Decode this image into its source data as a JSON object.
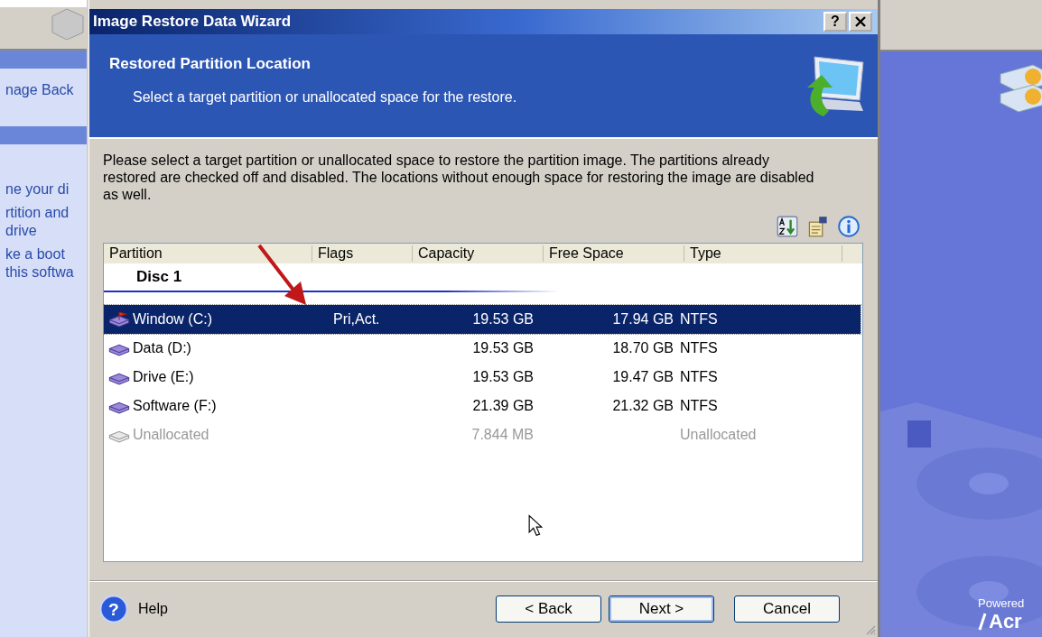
{
  "background_app": {
    "sidebar_sections": [
      {
        "items": [
          {
            "text": "nage Back"
          }
        ]
      },
      {
        "items": [
          {
            "text": "ne your di"
          },
          {
            "text": "rtition and drive"
          },
          {
            "text": "ke a boot this softwa"
          }
        ]
      }
    ],
    "powered_text": "Powered",
    "logo_text": "Acr"
  },
  "window": {
    "title": "Image Restore Data Wizard",
    "help_button": "?"
  },
  "header": {
    "title": "Restored Partition Location",
    "subtitle": "Select a target partition or unallocated space for the restore."
  },
  "instructions": "Please select a target partition or unallocated space to restore the partition image. The partitions already restored are checked off and disabled. The locations without enough space for restoring the image are disabled as well.",
  "table": {
    "columns": [
      "Partition",
      "Flags",
      "Capacity",
      "Free Space",
      "Type"
    ],
    "groups": [
      {
        "label": "Disc 1",
        "rows": [
          {
            "kind": "active",
            "name": "Window (C:)",
            "flags": "Pri,Act.",
            "capacity": "19.53 GB",
            "free_space": "17.94 GB",
            "type": "NTFS",
            "selected": true,
            "disabled": false
          },
          {
            "kind": "drive",
            "name": "Data (D:)",
            "capacity": "19.53 GB",
            "free_space": "18.70 GB",
            "type": "NTFS",
            "selected": false,
            "disabled": false
          },
          {
            "kind": "drive",
            "name": "Drive (E:)",
            "capacity": "19.53 GB",
            "free_space": "19.47 GB",
            "type": "NTFS",
            "selected": false,
            "disabled": false
          },
          {
            "kind": "drive",
            "name": "Software (F:)",
            "capacity": "21.39 GB",
            "free_space": "21.32 GB",
            "type": "NTFS",
            "selected": false,
            "disabled": false
          },
          {
            "kind": "drive",
            "name": "Unallocated",
            "capacity": "7.844 MB",
            "type": "Unallocated",
            "selected": false,
            "disabled": true
          }
        ]
      }
    ]
  },
  "footer": {
    "help_icon": "?",
    "help": "Help",
    "buttons": [
      {
        "label": "< Back",
        "default": false
      },
      {
        "label": "Next >",
        "default": true
      },
      {
        "label": "Cancel",
        "default": false
      }
    ]
  }
}
